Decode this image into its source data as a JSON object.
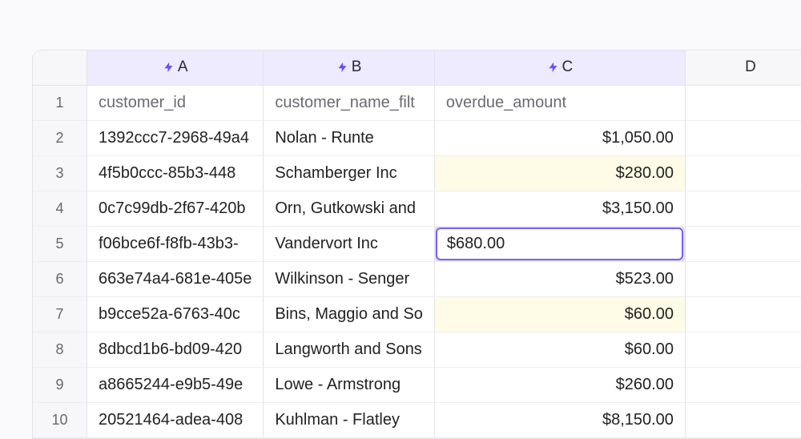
{
  "columns": [
    {
      "letter": "A",
      "bolt": true,
      "klass": "col-a",
      "plain": false
    },
    {
      "letter": "B",
      "bolt": true,
      "klass": "col-b",
      "plain": false
    },
    {
      "letter": "C",
      "bolt": true,
      "klass": "col-c",
      "plain": false
    },
    {
      "letter": "D",
      "bolt": false,
      "klass": "col-d",
      "plain": true
    }
  ],
  "field_headers": {
    "a": "customer_id",
    "b": "customer_name_filt",
    "c": "overdue_amount"
  },
  "rows": [
    {
      "n": "1",
      "a": "customer_id",
      "b": "customer_name_filt",
      "c": "overdue_amount",
      "isHeader": true
    },
    {
      "n": "2",
      "a": "1392ccc7-2968-49a4",
      "b": "Nolan - Runte",
      "c": "$1,050.00"
    },
    {
      "n": "3",
      "a": "4f5b0ccc-85b3-448",
      "b": "Schamberger Inc",
      "c": "$280.00",
      "highlight": true
    },
    {
      "n": "4",
      "a": "0c7c99db-2f67-420b",
      "b": "Orn, Gutkowski and",
      "c": "$3,150.00"
    },
    {
      "n": "5",
      "a": "f06bce6f-f8fb-43b3-",
      "b": "Vandervort Inc",
      "c": "$680.00",
      "selected": true
    },
    {
      "n": "6",
      "a": "663e74a4-681e-405e",
      "b": "Wilkinson - Senger",
      "c": "$523.00"
    },
    {
      "n": "7",
      "a": "b9cce52a-6763-40c",
      "b": "Bins, Maggio and So",
      "c": "$60.00",
      "highlight": true
    },
    {
      "n": "8",
      "a": "8dbcd1b6-bd09-420",
      "b": "Langworth and Sons",
      "c": "$60.00"
    },
    {
      "n": "9",
      "a": "a8665244-e9b5-49e",
      "b": "Lowe - Armstrong",
      "c": "$260.00"
    },
    {
      "n": "10",
      "a": "20521464-adea-408",
      "b": "Kuhlman - Flatley",
      "c": "$8,150.00"
    }
  ],
  "chart_data": {
    "type": "table",
    "columns": [
      "customer_id",
      "customer_name_filt",
      "overdue_amount"
    ],
    "rows": [
      [
        "1392ccc7-2968-49a4",
        "Nolan - Runte",
        1050.0
      ],
      [
        "4f5b0ccc-85b3-448",
        "Schamberger Inc",
        280.0
      ],
      [
        "0c7c99db-2f67-420b",
        "Orn, Gutkowski and",
        3150.0
      ],
      [
        "f06bce6f-f8fb-43b3-",
        "Vandervort Inc",
        680.0
      ],
      [
        "663e74a4-681e-405e",
        "Wilkinson - Senger",
        523.0
      ],
      [
        "b9cce52a-6763-40c",
        "Bins, Maggio and So",
        60.0
      ],
      [
        "8dbcd1b6-bd09-420",
        "Langworth and Sons",
        60.0
      ],
      [
        "a8665244-e9b5-49e",
        "Lowe - Armstrong",
        260.0
      ],
      [
        "20521464-adea-408",
        "Kuhlman - Flatley",
        8150.0
      ]
    ]
  }
}
